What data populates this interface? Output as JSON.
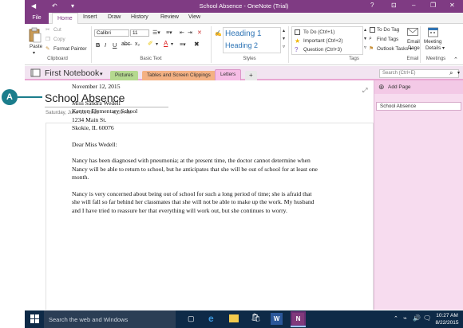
{
  "window": {
    "title": "School Absence - OneNote (Trial)",
    "controls": [
      "?",
      "⊡",
      "–",
      "❐",
      "✕"
    ]
  },
  "ribbon_tabs": [
    "File",
    "Home",
    "Insert",
    "Draw",
    "History",
    "Review",
    "View"
  ],
  "clipboard": {
    "paste_label": "Paste",
    "cut_label": "Cut",
    "copy_label": "Copy",
    "format_painter_label": "Format Painter",
    "group_label": "Clipboard"
  },
  "basic_text": {
    "font_name": "Calibri",
    "font_size": "11",
    "group_label": "Basic Text"
  },
  "styles": {
    "heading1": "Heading 1",
    "heading2": "Heading 2",
    "group_label": "Styles"
  },
  "tags": {
    "items": [
      "To Do (Ctrl+1)",
      "Important (Ctrl+2)",
      "Question (Ctrl+3)"
    ],
    "todo_tag": "To Do Tag",
    "find_tags": "Find Tags",
    "outlook_tasks": "Outlook Tasks",
    "group_label": "Tags"
  },
  "email": {
    "label_line1": "Email",
    "label_line2": "Page",
    "group_label": "Email"
  },
  "meetings": {
    "label_line1": "Meeting",
    "label_line2": "Details",
    "group_label": "Meetings"
  },
  "notebook": {
    "name": "First Notebook",
    "sections": [
      "Pictures",
      "Tables and Screen Clippings",
      "Letters",
      "+"
    ],
    "search_placeholder": "Search (Ctrl+E)"
  },
  "page_list": {
    "add_page": "Add Page",
    "pages": [
      "School Absence"
    ]
  },
  "page": {
    "title": "School Absence",
    "date": "Saturday, June 13, 2015",
    "time": "8:09 AM",
    "letter": {
      "date": "November 12, 2015",
      "address": [
        "Miss Sandra Wedell",
        "Kenton Elementary School",
        "1234 Main St.",
        "Skokie, IL 60076"
      ],
      "salutation": "Dear Miss Wedell:",
      "para1": "Nancy has been diagnosed with pneumonia; at the present time, the doctor cannot determine when Nancy will be able to return to school, but he anticipates that she will be out of school for at least one month.",
      "para2": "Nancy is very concerned about being out of school for such a long period of time; she is afraid that she will fall so far behind her classmates that she will not be able to make up the work. My husband and I have tried to reassure her that everything will work out, but she continues to worry."
    }
  },
  "taskbar": {
    "search_text": "Search the web and Windows",
    "time": "10:27 AM",
    "date": "8/22/2015"
  },
  "callout": {
    "label": "A"
  },
  "colors": {
    "onenote_purple": "#7f3b83",
    "section_pictures": "#b5d98f",
    "section_tables": "#f4b183",
    "section_letters": "#f7bde6",
    "taskbar": "#0e2a47",
    "callout": "#1b7d8c"
  }
}
